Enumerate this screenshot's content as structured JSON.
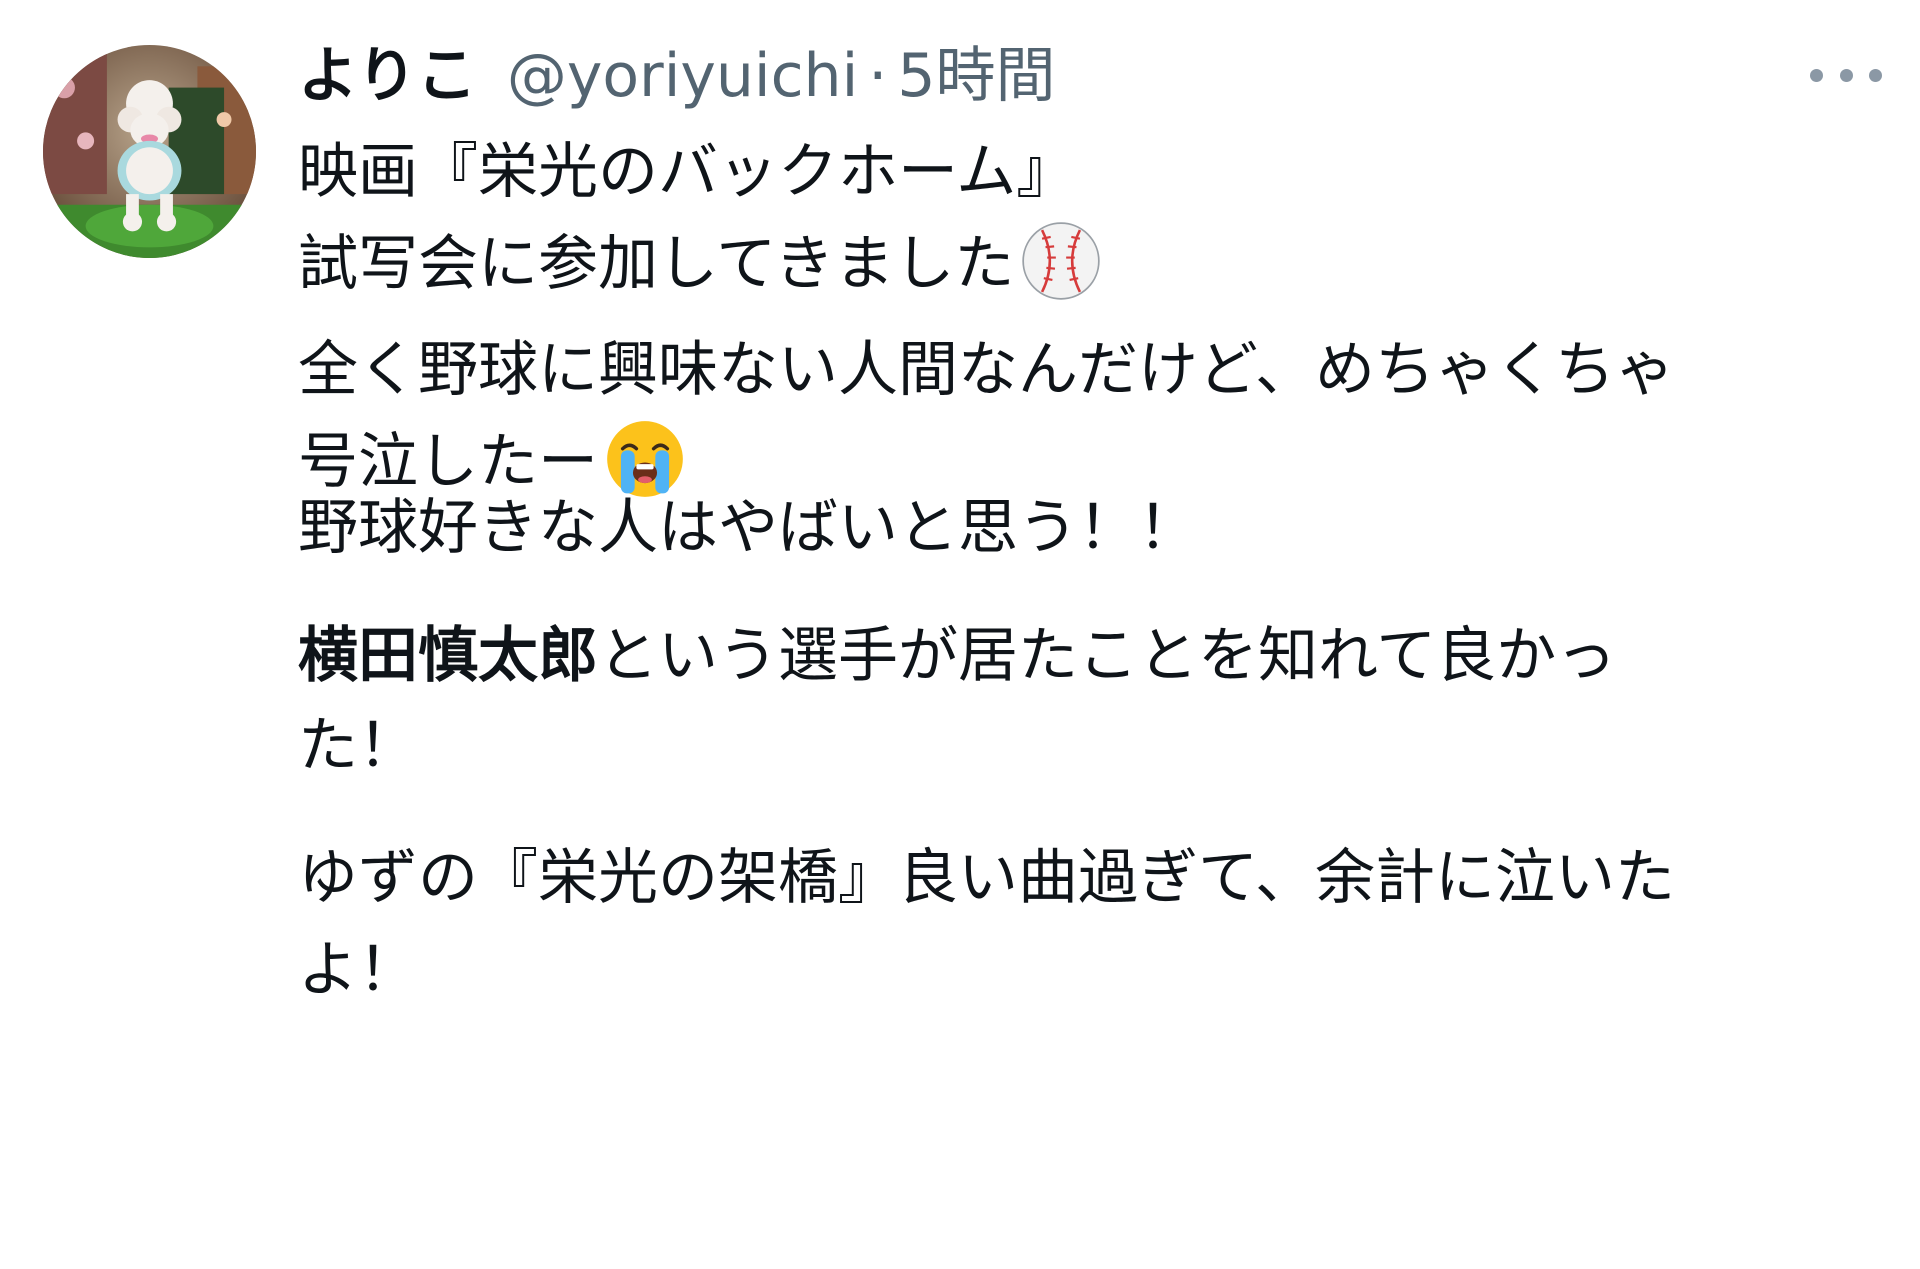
{
  "tweet": {
    "display_name": "よりこ",
    "handle": "@yoriyuichi",
    "separator": "·",
    "time": "5時間",
    "more_icon": "more-horizontal-icon",
    "avatar_icon": "poodle-avatar",
    "lines": [
      "映画『栄光のバックホーム』",
      "試写会に参加してきました",
      "全く野球に興味ない人間なんだけど、めちゃくちゃ",
      "号泣したー",
      "野球好きな人はやばいと思う！！",
      "横田慎太郎",
      "という選手が居たことを知れて良かっ",
      "た！",
      "ゆずの『栄光の架橋』良い曲過ぎて、余計に泣いた",
      "よ！"
    ],
    "emoji": {
      "baseball": "baseball-emoji",
      "crying": "loudly-crying-face-emoji"
    },
    "colors": {
      "text": "#0f1419",
      "secondary": "#536471"
    }
  }
}
